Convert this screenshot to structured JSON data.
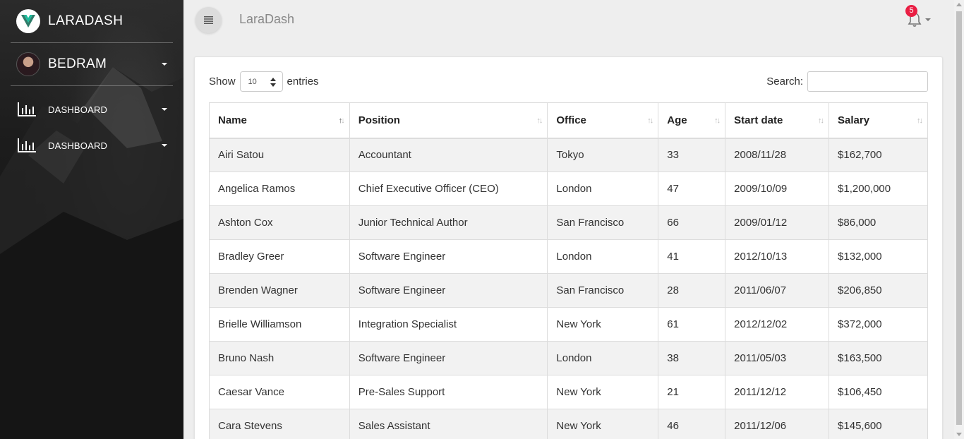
{
  "sidebar": {
    "brand": "LARADASH",
    "user": "BEDRAM",
    "nav": [
      {
        "label": "DASHBOARD"
      },
      {
        "label": "DASHBOARD"
      }
    ]
  },
  "topbar": {
    "title": "LaraDash",
    "notification_count": "5"
  },
  "table_controls": {
    "show_label": "Show",
    "entries_value": "10",
    "entries_label": "entries",
    "search_label": "Search:"
  },
  "table": {
    "columns": [
      "Name",
      "Position",
      "Office",
      "Age",
      "Start date",
      "Salary"
    ],
    "rows": [
      [
        "Airi Satou",
        "Accountant",
        "Tokyo",
        "33",
        "2008/11/28",
        "$162,700"
      ],
      [
        "Angelica Ramos",
        "Chief Executive Officer (CEO)",
        "London",
        "47",
        "2009/10/09",
        "$1,200,000"
      ],
      [
        "Ashton Cox",
        "Junior Technical Author",
        "San Francisco",
        "66",
        "2009/01/12",
        "$86,000"
      ],
      [
        "Bradley Greer",
        "Software Engineer",
        "London",
        "41",
        "2012/10/13",
        "$132,000"
      ],
      [
        "Brenden Wagner",
        "Software Engineer",
        "San Francisco",
        "28",
        "2011/06/07",
        "$206,850"
      ],
      [
        "Brielle Williamson",
        "Integration Specialist",
        "New York",
        "61",
        "2012/12/02",
        "$372,000"
      ],
      [
        "Bruno Nash",
        "Software Engineer",
        "London",
        "38",
        "2011/05/03",
        "$163,500"
      ],
      [
        "Caesar Vance",
        "Pre-Sales Support",
        "New York",
        "21",
        "2011/12/12",
        "$106,450"
      ],
      [
        "Cara Stevens",
        "Sales Assistant",
        "New York",
        "46",
        "2011/12/06",
        "$145,600"
      ]
    ]
  },
  "colors": {
    "brand_logo": "#1abc9c",
    "badge": "#e91e43"
  }
}
